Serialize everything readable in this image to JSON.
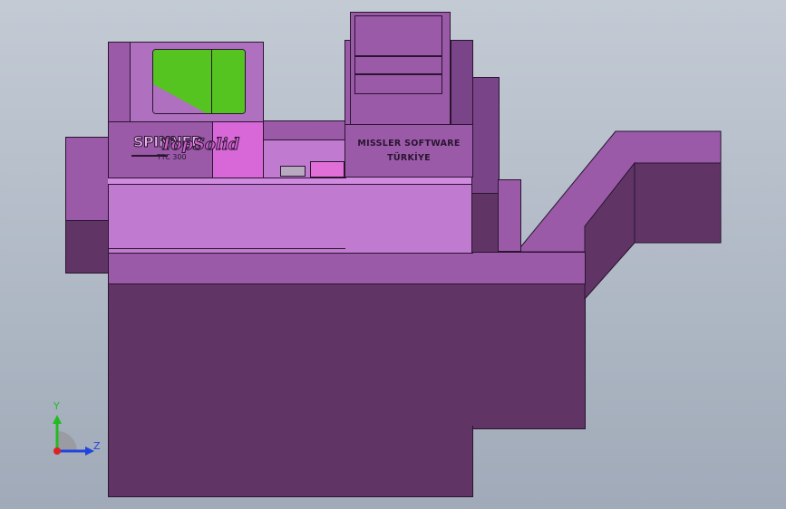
{
  "model": {
    "brand_label_line1": "MISSLER SOFTWARE",
    "brand_label_line2": "TÜRKİYE",
    "logo_text_1": "SPINNER",
    "logo_text_2": "TopSolid",
    "logo_text_3": "TTC 300"
  },
  "triad": {
    "y_label": "Y",
    "z_label": "Z"
  },
  "colors": {
    "background_top": "#c3cad4",
    "background_bottom": "#a0aab8",
    "body_dark": "#603566",
    "body_mid": "#9a5aa8",
    "body_light": "#c07ad0",
    "screen_green": "#55c420",
    "axis_y": "#22bb22",
    "axis_z": "#2244dd",
    "axis_x": "#dd2222"
  }
}
